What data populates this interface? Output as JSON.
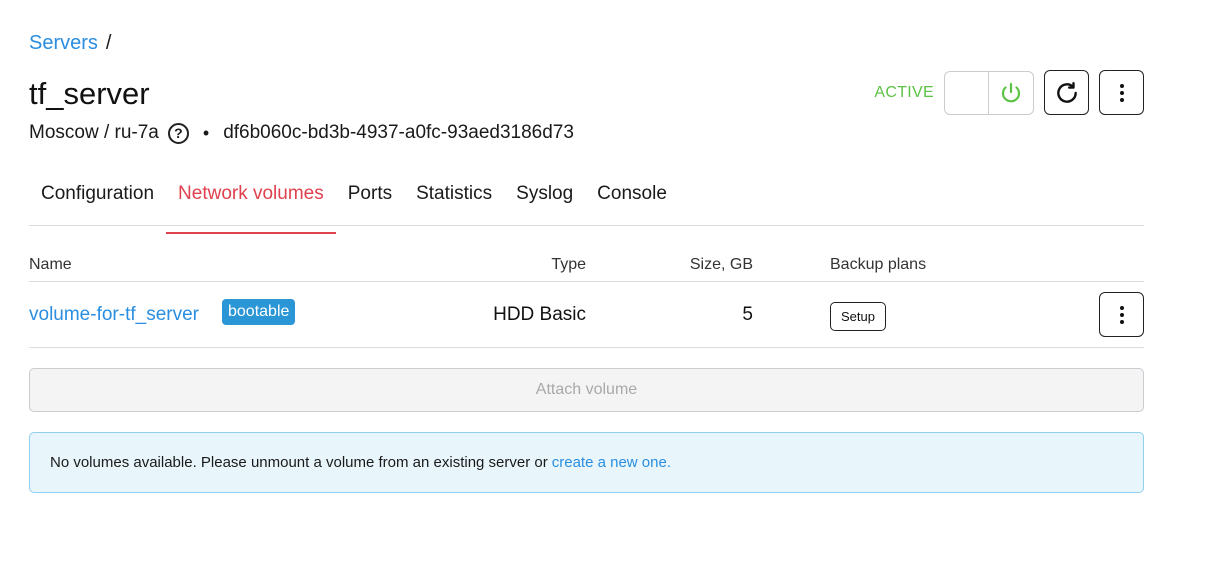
{
  "breadcrumb": {
    "link": "Servers",
    "separator": "/"
  },
  "server": {
    "name": "tf_server",
    "location": "Moscow / ru-7a",
    "bullet": "•",
    "id": "df6b060c-bd3b-4937-a0fc-93aed3186d73"
  },
  "status": {
    "label": "ACTIVE",
    "color": "#5cc245"
  },
  "icons": {
    "help": "question-circle-icon",
    "power": "power-icon",
    "reboot": "reboot-icon",
    "menu": "vertical-dots-icon"
  },
  "tabs": [
    {
      "label": "Configuration",
      "active": false
    },
    {
      "label": "Network volumes",
      "active": true
    },
    {
      "label": "Ports",
      "active": false
    },
    {
      "label": "Statistics",
      "active": false
    },
    {
      "label": "Syslog",
      "active": false
    },
    {
      "label": "Console",
      "active": false
    }
  ],
  "table": {
    "headers": {
      "name": "Name",
      "type": "Type",
      "size": "Size, GB",
      "backup": "Backup plans"
    },
    "rows": [
      {
        "name": "volume-for-tf_server",
        "badge": "bootable",
        "type": "HDD Basic",
        "size": "5",
        "backup_button": "Setup"
      }
    ]
  },
  "attach_button": "Attach volume",
  "info": {
    "text": "No volumes available. Please unmount a volume from an existing server or",
    "link": "create a new one."
  },
  "colors": {
    "accent": "#2a8ee0",
    "tab_active": "#e0414e",
    "status_active": "#5cc245"
  }
}
